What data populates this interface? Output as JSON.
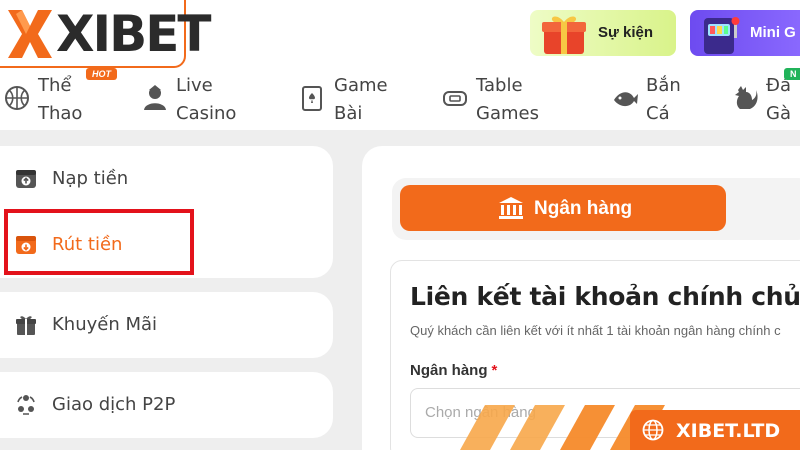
{
  "header": {
    "logo_text": "XIBET",
    "promos": [
      {
        "label": "Sự kiện",
        "icon": "gift-box-icon"
      },
      {
        "label": "Mini G",
        "icon": "slot-machine-icon"
      }
    ]
  },
  "nav": {
    "items": [
      {
        "label": "Thể\nThao",
        "icon": "basketball-icon",
        "badge": "HOT"
      },
      {
        "label": "Live\nCasino",
        "icon": "dealer-icon"
      },
      {
        "label": "Game\nBài",
        "icon": "playing-cards-icon"
      },
      {
        "label": "Table\nGames",
        "icon": "table-games-icon"
      },
      {
        "label": "Bắn\nCá",
        "icon": "fish-icon"
      },
      {
        "label": "Đá\nGà",
        "icon": "rooster-icon"
      }
    ],
    "new_badge": "N"
  },
  "sidebar": {
    "items": [
      {
        "label": "Nạp tiền",
        "icon": "deposit-wallet-icon"
      },
      {
        "label": "Rút tiền",
        "icon": "withdraw-wallet-icon",
        "active": true
      },
      {
        "label": "Khuyến Mãi",
        "icon": "gift-icon"
      },
      {
        "label": "Giao dịch P2P",
        "icon": "p2p-users-icon"
      }
    ]
  },
  "main": {
    "tab_label": "Ngân hàng",
    "form_title": "Liên kết tài khoản chính chủ",
    "form_subtitle": "Quý khách cần liên kết với ít nhất 1 tài khoản ngân hàng chính c",
    "bank_field_label": "Ngân hàng",
    "bank_field_required": "*",
    "bank_field_placeholder": "Chọn ngân hàng"
  },
  "watermark": {
    "text": "XIBET.LTD"
  },
  "colors": {
    "accent": "#f26a1b",
    "highlight": "#e3121b",
    "promo_event_bg": "#d9f38a",
    "promo_mini_bg": "#7a5af5"
  }
}
